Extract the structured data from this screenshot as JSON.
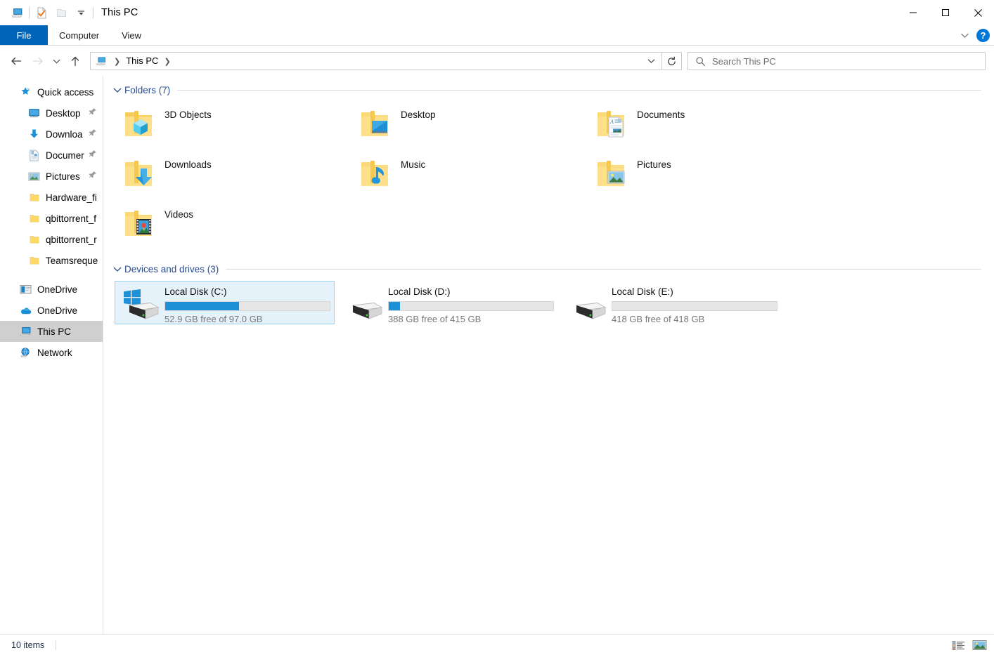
{
  "window": {
    "title": "This PC",
    "quick_access": [
      {
        "name": "this-pc-icon",
        "label": "This PC"
      },
      {
        "name": "properties-icon",
        "label": "Properties"
      },
      {
        "name": "new-folder-icon",
        "label": "New folder"
      },
      {
        "name": "customize-dropdown-icon",
        "label": "Customize Quick Access Toolbar"
      }
    ],
    "controls": {
      "minimize": "Minimize",
      "maximize": "Maximize",
      "close": "Close"
    }
  },
  "ribbon": {
    "tabs": [
      {
        "label": "File",
        "active": true
      },
      {
        "label": "Computer",
        "active": false
      },
      {
        "label": "View",
        "active": false
      }
    ],
    "expand_label": "Expand the Ribbon",
    "help_label": "?"
  },
  "navbar": {
    "back_label": "Back",
    "forward_label": "Forward",
    "recent_label": "Recent locations",
    "up_label": "Up",
    "breadcrumb": [
      {
        "label": "This PC"
      }
    ],
    "dropdown_label": "Previous Locations",
    "refresh_label": "Refresh",
    "search": {
      "placeholder": "Search This PC",
      "value": ""
    }
  },
  "sidebar": {
    "groups": [
      {
        "name": "quick-access",
        "root": {
          "label": "Quick access",
          "icon": "star-pin-icon"
        },
        "items": [
          {
            "label": "Desktop",
            "icon": "desktop-icon",
            "pinned": true
          },
          {
            "label": "Downloa",
            "icon": "downloads-icon",
            "pinned": true
          },
          {
            "label": "Documer",
            "icon": "documents-icon",
            "pinned": true
          },
          {
            "label": "Pictures",
            "icon": "pictures-icon",
            "pinned": true
          },
          {
            "label": "Hardware_fi",
            "icon": "folder-icon",
            "pinned": false
          },
          {
            "label": "qbittorrent_f",
            "icon": "folder-icon",
            "pinned": false
          },
          {
            "label": "qbittorrent_r",
            "icon": "folder-icon",
            "pinned": false
          },
          {
            "label": "Teamsreque",
            "icon": "folder-icon",
            "pinned": false
          }
        ]
      }
    ],
    "roots": [
      {
        "label": "OneDrive",
        "icon": "onedrive-business-icon",
        "selected": false
      },
      {
        "label": "OneDrive",
        "icon": "onedrive-cloud-icon",
        "selected": false
      },
      {
        "label": "This PC",
        "icon": "this-pc-icon",
        "selected": true
      },
      {
        "label": "Network",
        "icon": "network-icon",
        "selected": false
      }
    ]
  },
  "content": {
    "folders_group": {
      "title": "Folders (7)",
      "expanded": true,
      "items": [
        {
          "label": "3D Objects",
          "icon": "folder-3d-objects-icon"
        },
        {
          "label": "Desktop",
          "icon": "folder-desktop-icon"
        },
        {
          "label": "Documents",
          "icon": "folder-documents-icon"
        },
        {
          "label": "Downloads",
          "icon": "folder-downloads-icon"
        },
        {
          "label": "Music",
          "icon": "folder-music-icon"
        },
        {
          "label": "Pictures",
          "icon": "folder-pictures-icon"
        },
        {
          "label": "Videos",
          "icon": "folder-videos-icon"
        }
      ]
    },
    "drives_group": {
      "title": "Devices and drives (3)",
      "expanded": true,
      "items": [
        {
          "label": "Local Disk (C:)",
          "icon": "windows-drive-icon",
          "free_text": "52.9 GB free of 97.0 GB",
          "used_percent": 45,
          "selected": true,
          "bar_color": "#1e90d8"
        },
        {
          "label": "Local Disk (D:)",
          "icon": "drive-icon",
          "free_text": "388 GB free of 415 GB",
          "used_percent": 7,
          "selected": false,
          "bar_color": "#1e90d8"
        },
        {
          "label": "Local Disk (E:)",
          "icon": "drive-icon",
          "free_text": "418 GB free of 418 GB",
          "used_percent": 0,
          "selected": false,
          "bar_color": "#1e90d8"
        }
      ]
    }
  },
  "statusbar": {
    "item_count": "10 items",
    "view_buttons": [
      {
        "name": "details-view-button",
        "label": "Details view"
      },
      {
        "name": "large-icons-view-button",
        "label": "Large icons view"
      }
    ]
  },
  "colors": {
    "accent": "#0065b8",
    "group_header": "#2a4d8f",
    "selection": "#cfcfcf",
    "drive_bar": "#1e90d8",
    "help_blue": "#0078d7"
  }
}
